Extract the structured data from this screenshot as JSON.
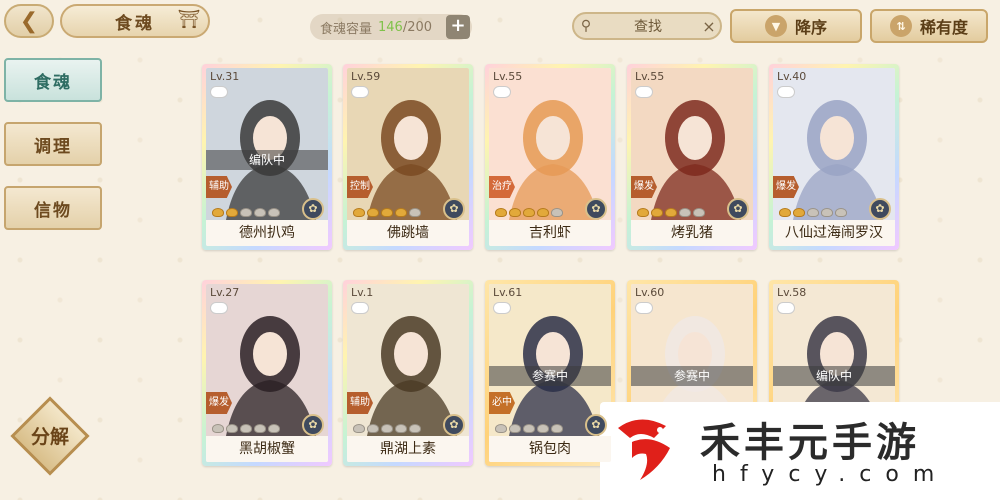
{
  "header": {
    "back_icon": "back-arrow-icon",
    "title": "食魂",
    "pagoda_icon": "pagoda-icon",
    "capacity_label": "食魂容量",
    "capacity_current": "146",
    "capacity_total": "/200",
    "add_label": "+",
    "search_placeholder": "查找",
    "search_clear": "×",
    "sort_order": "降序",
    "sort_key": "稀有度"
  },
  "sidebar": {
    "items": [
      {
        "label": "食魂",
        "active": true
      },
      {
        "label": "调理",
        "active": false
      },
      {
        "label": "信物",
        "active": false
      }
    ],
    "decompose_label": "分解"
  },
  "cards": [
    {
      "level": "Lv.31",
      "name": "德州扒鸡",
      "status": "编队中",
      "role": "辅助",
      "stars": 2,
      "frame": "rainbow"
    },
    {
      "level": "Lv.59",
      "name": "佛跳墙",
      "status": "",
      "role": "控制",
      "stars": 4,
      "frame": "rainbow"
    },
    {
      "level": "Lv.55",
      "name": "吉利虾",
      "status": "",
      "role": "治疗",
      "stars": 4,
      "frame": "rainbow"
    },
    {
      "level": "Lv.55",
      "name": "烤乳猪",
      "status": "",
      "role": "爆发",
      "stars": 3,
      "frame": "rainbow"
    },
    {
      "level": "Lv.40",
      "name": "八仙过海闹罗汉",
      "status": "",
      "role": "爆发",
      "stars": 2,
      "frame": "rainbow"
    },
    {
      "level": "Lv.27",
      "name": "黑胡椒蟹",
      "status": "",
      "role": "爆发",
      "stars": 0,
      "frame": "rainbow"
    },
    {
      "level": "Lv.1",
      "name": "鼎湖上素",
      "status": "",
      "role": "辅助",
      "stars": 0,
      "frame": "rainbow"
    },
    {
      "level": "Lv.61",
      "name": "锅包肉",
      "status": "参赛中",
      "role": "必中",
      "stars": 0,
      "frame": "gold"
    },
    {
      "level": "Lv.60",
      "name": "",
      "status": "参赛中",
      "role": "",
      "stars": 0,
      "frame": "gold"
    },
    {
      "level": "Lv.58",
      "name": "",
      "status": "编队中",
      "role": "",
      "stars": 0,
      "frame": "gold"
    }
  ],
  "watermark": {
    "text": "禾丰元手游",
    "url": "hfycy.com"
  },
  "colors": {
    "background": "#f7f0e3",
    "accent_gold": "#c9a66a",
    "active_tab": "#7eb3a6",
    "capacity_green": "#7fc24a"
  }
}
